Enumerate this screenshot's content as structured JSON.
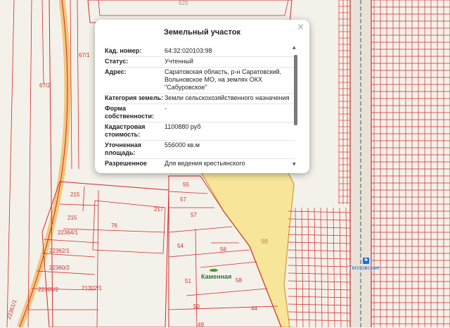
{
  "map": {
    "parcel_numbers": [
      "67/1",
      "67/2",
      "215",
      "215",
      "76",
      "217",
      "55",
      "57",
      "57",
      "54",
      "56",
      "51",
      "58",
      "50",
      "44",
      "49",
      "98",
      "22364/1",
      "22362/1",
      "22360/2",
      "22365/2",
      "21302/1",
      "22361/1",
      "629"
    ],
    "place_name": "Каменная",
    "station_name": "Тепловская",
    "station_icon": "train-station-icon",
    "colors": {
      "boundary": "#d12b2b",
      "highlight_fill": "#f7e69a",
      "highlight_stroke": "#e0a64a",
      "road": "#f3c77a",
      "background": "#f4f1ea"
    }
  },
  "popup": {
    "title": "Земельный участок",
    "close_icon": "close-icon",
    "rows": [
      {
        "key": "Кад. номер:",
        "value": "64:32:020103:98"
      },
      {
        "key": "Статус:",
        "value": "Учтенный"
      },
      {
        "key": "Адрес:",
        "value": "Саратовская область, р-н Саратовский, Вольновское МО, на землях ОКХ \"Сабуровское\""
      },
      {
        "key": "Категория земель:",
        "value": "Земли сельскохозяйственного назначения"
      },
      {
        "key": "Форма собственности:",
        "value": "-"
      },
      {
        "key": "Кадастровая стоимость:",
        "value": "1100880 руб"
      },
      {
        "key": "Уточненная площадь:",
        "value": "556000 кв.м"
      },
      {
        "key": "Разрешенное",
        "value": "Для ведения крестьянского"
      }
    ]
  }
}
